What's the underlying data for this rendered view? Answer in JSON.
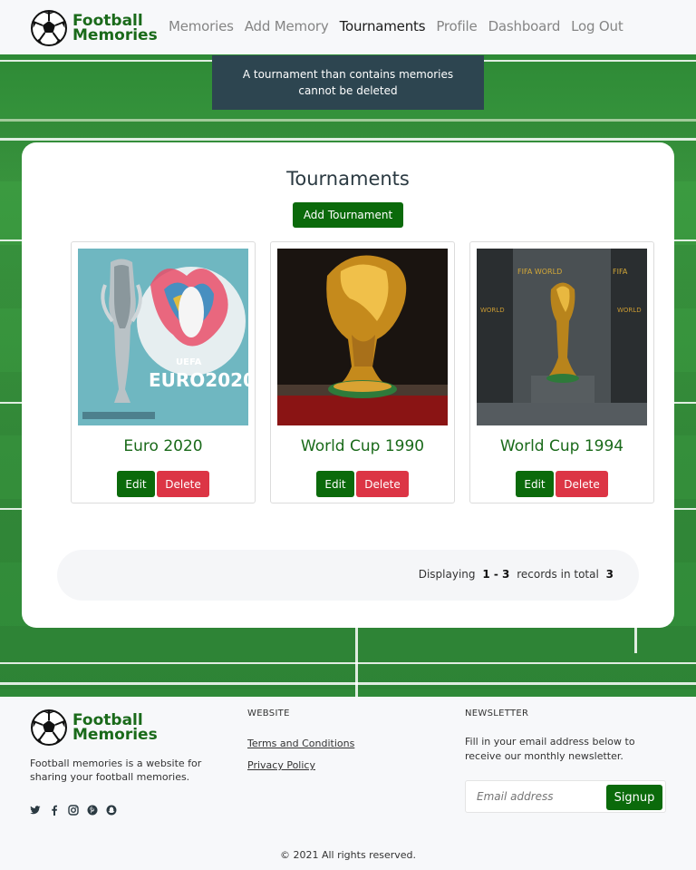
{
  "header": {
    "logo_line1": "Football",
    "logo_line2": "Memories",
    "nav": [
      "Memories",
      "Add Memory",
      "Tournaments",
      "Profile",
      "Dashboard",
      "Log Out"
    ],
    "active": "Tournaments"
  },
  "alert": {
    "message": "A tournament than contains memories cannot be deleted"
  },
  "main": {
    "title": "Tournaments",
    "add_label": "Add Tournament",
    "tournaments": [
      {
        "name": "Euro 2020",
        "edit_label": "Edit",
        "delete_label": "Delete",
        "image": "euro-2020-trophy"
      },
      {
        "name": "World Cup 1990",
        "edit_label": "Edit",
        "delete_label": "Delete",
        "image": "world-cup-trophy-red"
      },
      {
        "name": "World Cup 1994",
        "edit_label": "Edit",
        "delete_label": "Delete",
        "image": "world-cup-trophy-dark"
      }
    ],
    "pager": {
      "prefix": "Displaying",
      "range": "1 - 3",
      "middle": "records in total",
      "total": "3"
    }
  },
  "footer": {
    "logo_line1": "Football",
    "logo_line2": "Memories",
    "description": "Football memories is a website for sharing your football memories.",
    "social_icons": [
      "twitter-icon",
      "facebook-icon",
      "instagram-icon",
      "pinterest-icon",
      "snapchat-icon"
    ],
    "website_heading": "WEBSITE",
    "links": [
      "Terms and Conditions",
      "Privacy Policy"
    ],
    "newsletter_heading": "NEWSLETTER",
    "newsletter_text": "Fill in your email address below to receive our monthly newsletter.",
    "email_placeholder": "Email address",
    "signup_label": "Signup",
    "copyright": "© 2021 All rights reserved."
  },
  "colors": {
    "brand_green": "#0b6a0b",
    "danger": "#dc3545",
    "alert_bg": "#2d4550"
  }
}
